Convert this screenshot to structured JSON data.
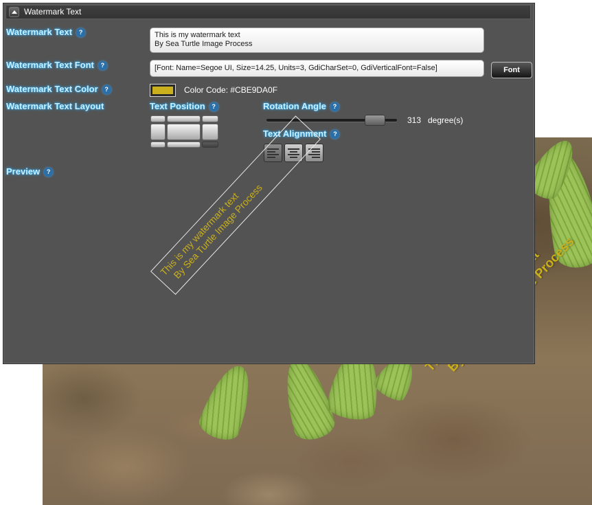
{
  "panel": {
    "title": "Watermark Text",
    "collapse_icon": "chevron-up-icon"
  },
  "fields": {
    "watermark_text_label": "Watermark Text",
    "watermark_text_line1": "This is my watermark text",
    "watermark_text_line2": "By Sea Turtle Image Process",
    "font_label": "Watermark Text Font",
    "font_value": "[Font: Name=Segoe UI, Size=14.25, Units=3, GdiCharSet=0, GdiVerticalFont=False]",
    "font_button": "Font",
    "color_label": "Watermark Text Color",
    "color_code_text": "Color Code: #CBE9DA0F",
    "layout_label": "Watermark Text Layout",
    "preview_label": "Preview",
    "help_glyph": "?"
  },
  "layout": {
    "text_position_label": "Text Position",
    "selected_position": "bottom-right",
    "rotation_label": "Rotation Angle",
    "rotation_value": "313",
    "rotation_unit": "degree(s)",
    "text_alignment_label": "Text Alignment",
    "alignments": [
      "align-left-icon",
      "align-center-icon",
      "align-right-icon"
    ],
    "selected_alignment": "left"
  },
  "colors": {
    "watermark_color": "#c9b01c",
    "label_glow": "#33b5ff",
    "panel_bg": "#535353"
  },
  "photo_watermark": {
    "line1": "This is my watermark text",
    "line2": "By Sea Turtle Image Process"
  }
}
